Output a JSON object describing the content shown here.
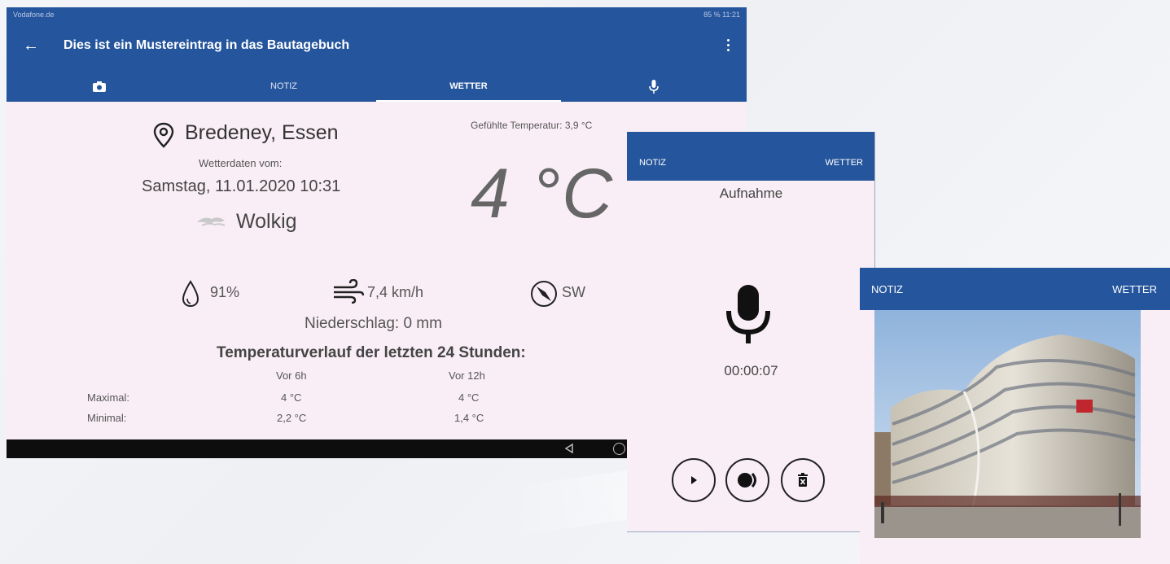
{
  "status": {
    "carrier": "Vodafone.de",
    "right": "85 % 11:21"
  },
  "header": {
    "back_icon": "arrow-back-icon",
    "title": "Dies ist ein Mustereintrag in das Bautagebuch"
  },
  "tabs": [
    {
      "label": "",
      "icon": "camera-icon"
    },
    {
      "label": "NOTIZ"
    },
    {
      "label": "WETTER",
      "active": true
    },
    {
      "label": "",
      "icon": "microphone-icon"
    }
  ],
  "weather": {
    "location": "Bredeney, Essen",
    "from_label": "Wetterdaten vom:",
    "datetime": "Samstag, 11.01.2020 10:31",
    "condition": "Wolkig",
    "feels_like": "Gefühlte Temperatur: 3,9 °C",
    "temperature": "4 °C",
    "humidity": "91%",
    "wind_speed": "7,4 km/h",
    "wind_dir": "SW",
    "precipitation": "Niederschlag: 0 mm",
    "history_title": "Temperaturverlauf der letzten 24 Stunden:",
    "history": {
      "columns": [
        "Vor 6h",
        "Vor 12h"
      ],
      "rows": [
        {
          "label": "Maximal:",
          "values": [
            "4 °C",
            "4 °C"
          ]
        },
        {
          "label": "Minimal:",
          "values": [
            "2,2 °C",
            "1,4 °C"
          ]
        }
      ]
    }
  },
  "recording": {
    "tab_left": "NOTIZ",
    "tab_right": "WETTER",
    "title": "Aufnahme",
    "time": "00:00:07"
  },
  "photo_screen": {
    "tab_left": "NOTIZ",
    "tab_right": "WETTER"
  }
}
